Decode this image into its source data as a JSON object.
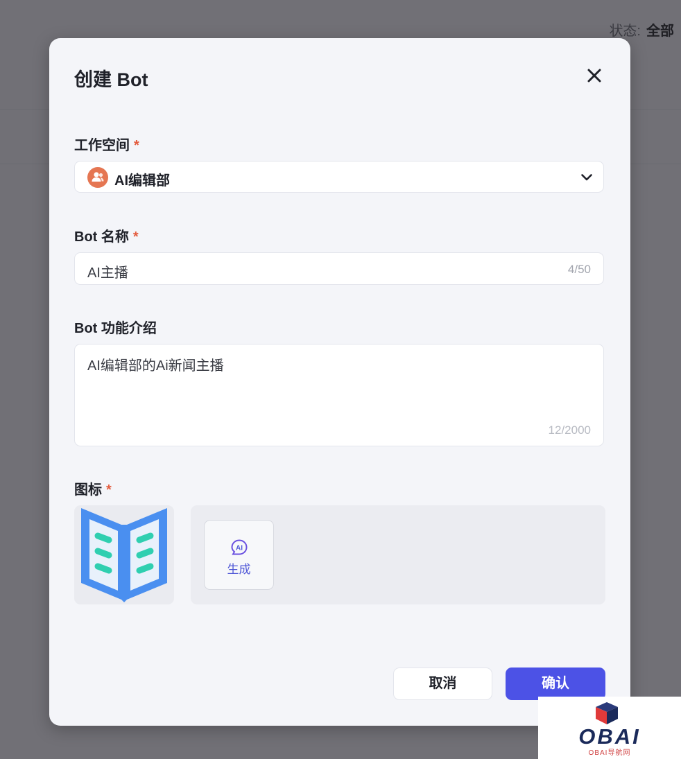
{
  "background": {
    "status_label": "状态:",
    "status_value": "全部"
  },
  "modal": {
    "title": "创建 Bot",
    "close_icon": "close-icon",
    "workspace": {
      "label": "工作空间",
      "required": "*",
      "selected": "AI编辑部",
      "avatar_icon": "team-icon",
      "avatar_color": "#e57652"
    },
    "bot_name": {
      "label": "Bot 名称",
      "required": "*",
      "value": "AI主播",
      "counter": "4/50"
    },
    "bot_description": {
      "label": "Bot 功能介绍",
      "value": "AI编辑部的Ai新闻主播",
      "counter": "12/2000"
    },
    "icon": {
      "label": "图标",
      "required": "*",
      "preview_icon": "open-book-icon",
      "generate_label": "生成",
      "generate_icon": "ai-chat-icon"
    },
    "buttons": {
      "cancel": "取消",
      "confirm": "确认"
    }
  },
  "watermark": {
    "text": "OBAI",
    "sub": "OBAI导航网"
  },
  "colors": {
    "accent": "#4c52e6",
    "required": "#e35b3d",
    "book_blue": "#4a8ff0",
    "book_green": "#2fcfb0"
  }
}
